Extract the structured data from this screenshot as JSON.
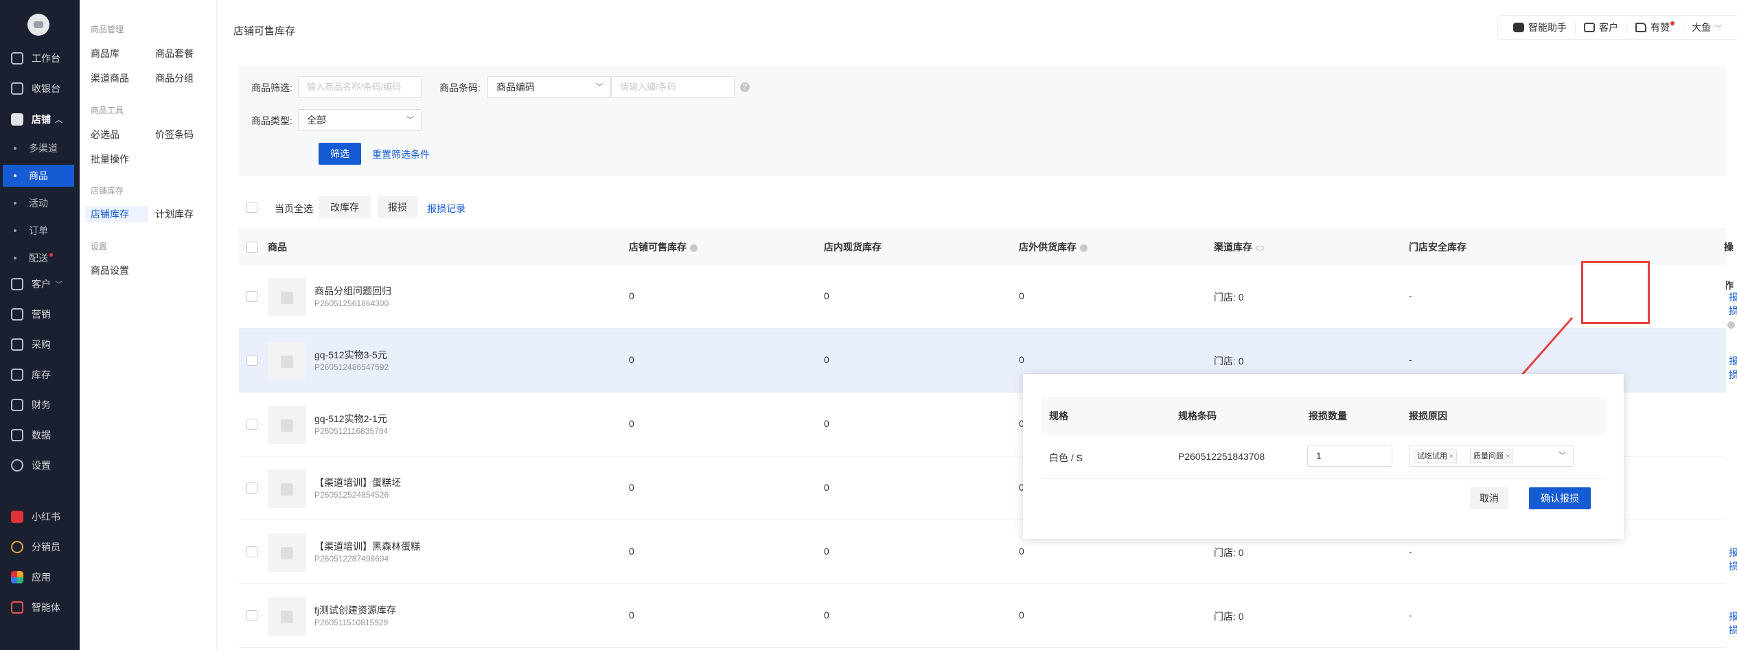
{
  "nav1": {
    "items": [
      {
        "label": "工作台",
        "icon": "workbench-icon"
      },
      {
        "label": "收银台",
        "icon": "cashier-icon"
      },
      {
        "label": "店铺",
        "icon": "store-icon"
      },
      {
        "label": "客户",
        "icon": "customer-icon"
      },
      {
        "label": "营销",
        "icon": "marketing-icon"
      },
      {
        "label": "采购",
        "icon": "cart-icon"
      },
      {
        "label": "库存",
        "icon": "inventory-icon"
      },
      {
        "label": "财务",
        "icon": "finance-icon"
      },
      {
        "label": "数据",
        "icon": "chart-icon"
      },
      {
        "label": "设置",
        "icon": "settings-icon"
      }
    ],
    "store_subs": [
      "多渠道",
      "商品",
      "活动",
      "订单",
      "配送"
    ],
    "apps": [
      {
        "label": "小红书",
        "icon": "xiaohongshu-icon"
      },
      {
        "label": "分销员",
        "icon": "distributor-icon"
      },
      {
        "label": "应用",
        "icon": "apps-icon"
      },
      {
        "label": "智能体",
        "icon": "agent-icon"
      }
    ]
  },
  "nav2": {
    "groups": [
      {
        "title": "商品管理",
        "links": [
          "商品库",
          "商品套餐",
          "渠道商品",
          "商品分组"
        ]
      },
      {
        "title": "商品工具",
        "links": [
          "必选品",
          "价签条码",
          "批量操作"
        ]
      },
      {
        "title": "店铺库存",
        "links": [
          "店铺库存",
          "计划库存"
        ]
      },
      {
        "title": "设置",
        "links": [
          "商品设置"
        ]
      }
    ]
  },
  "header": {
    "title": "店铺可售库存",
    "tools": [
      "智能助手",
      "客户",
      "有赞",
      "大鱼"
    ]
  },
  "filters": {
    "goods_label": "商品筛选:",
    "goods_placeholder": "输入商品名称/条码/编码",
    "code_label": "商品条码:",
    "code_select": "商品编码",
    "code_placeholder": "请输入编/条码",
    "type_label": "商品类型:",
    "type_select": "全部",
    "filter_btn": "筛选",
    "reset_link": "重置筛选条件"
  },
  "batch": {
    "select_all": "当页全选",
    "modify_btn": "改库存",
    "loss_btn": "报损",
    "loss_record": "报损记录"
  },
  "table": {
    "columns": [
      "商品",
      "店铺可售库存",
      "店内现货库存",
      "店外供货库存",
      "渠道库存",
      "门店安全库存",
      "操作"
    ],
    "rows": [
      {
        "name": "商品分组问题回归",
        "code": "P260512561864300",
        "sellable": "0",
        "instore": "0",
        "outstore": "0",
        "channel": "门店: 0",
        "safety": "-",
        "op": "报损"
      },
      {
        "name": "gq-512实物3-5元",
        "code": "P260512486547592",
        "sellable": "0",
        "instore": "0",
        "outstore": "0",
        "channel": "门店: 0",
        "safety": "-",
        "op": "报损"
      },
      {
        "name": "gq-512实物2-1元",
        "code": "P260512116835784",
        "sellable": "0",
        "instore": "0",
        "outstore": "0",
        "channel": "",
        "safety": "",
        "op": ""
      },
      {
        "name": "【渠道培训】蛋糕坯",
        "code": "P260512524854526",
        "sellable": "0",
        "instore": "0",
        "outstore": "0",
        "channel": "",
        "safety": "",
        "op": ""
      },
      {
        "name": "【渠道培训】黑森林蛋糕",
        "code": "P260512287498694",
        "sellable": "0",
        "instore": "0",
        "outstore": "0",
        "channel": "门店: 0",
        "safety": "-",
        "op": "报损"
      },
      {
        "name": "fj测试创建资源库存",
        "code": "P260511510815929",
        "sellable": "0",
        "instore": "0",
        "outstore": "0",
        "channel": "门店: 0",
        "safety": "-",
        "op": "报损"
      }
    ]
  },
  "popover": {
    "columns": [
      "规格",
      "规格条码",
      "报损数量",
      "报损原因"
    ],
    "row": {
      "spec": "白色 / S",
      "barcode": "P260512251843708",
      "qty": "1",
      "reasons": [
        "试吃试用",
        "质量问题"
      ]
    },
    "cancel": "取消",
    "confirm": "确认报损"
  }
}
